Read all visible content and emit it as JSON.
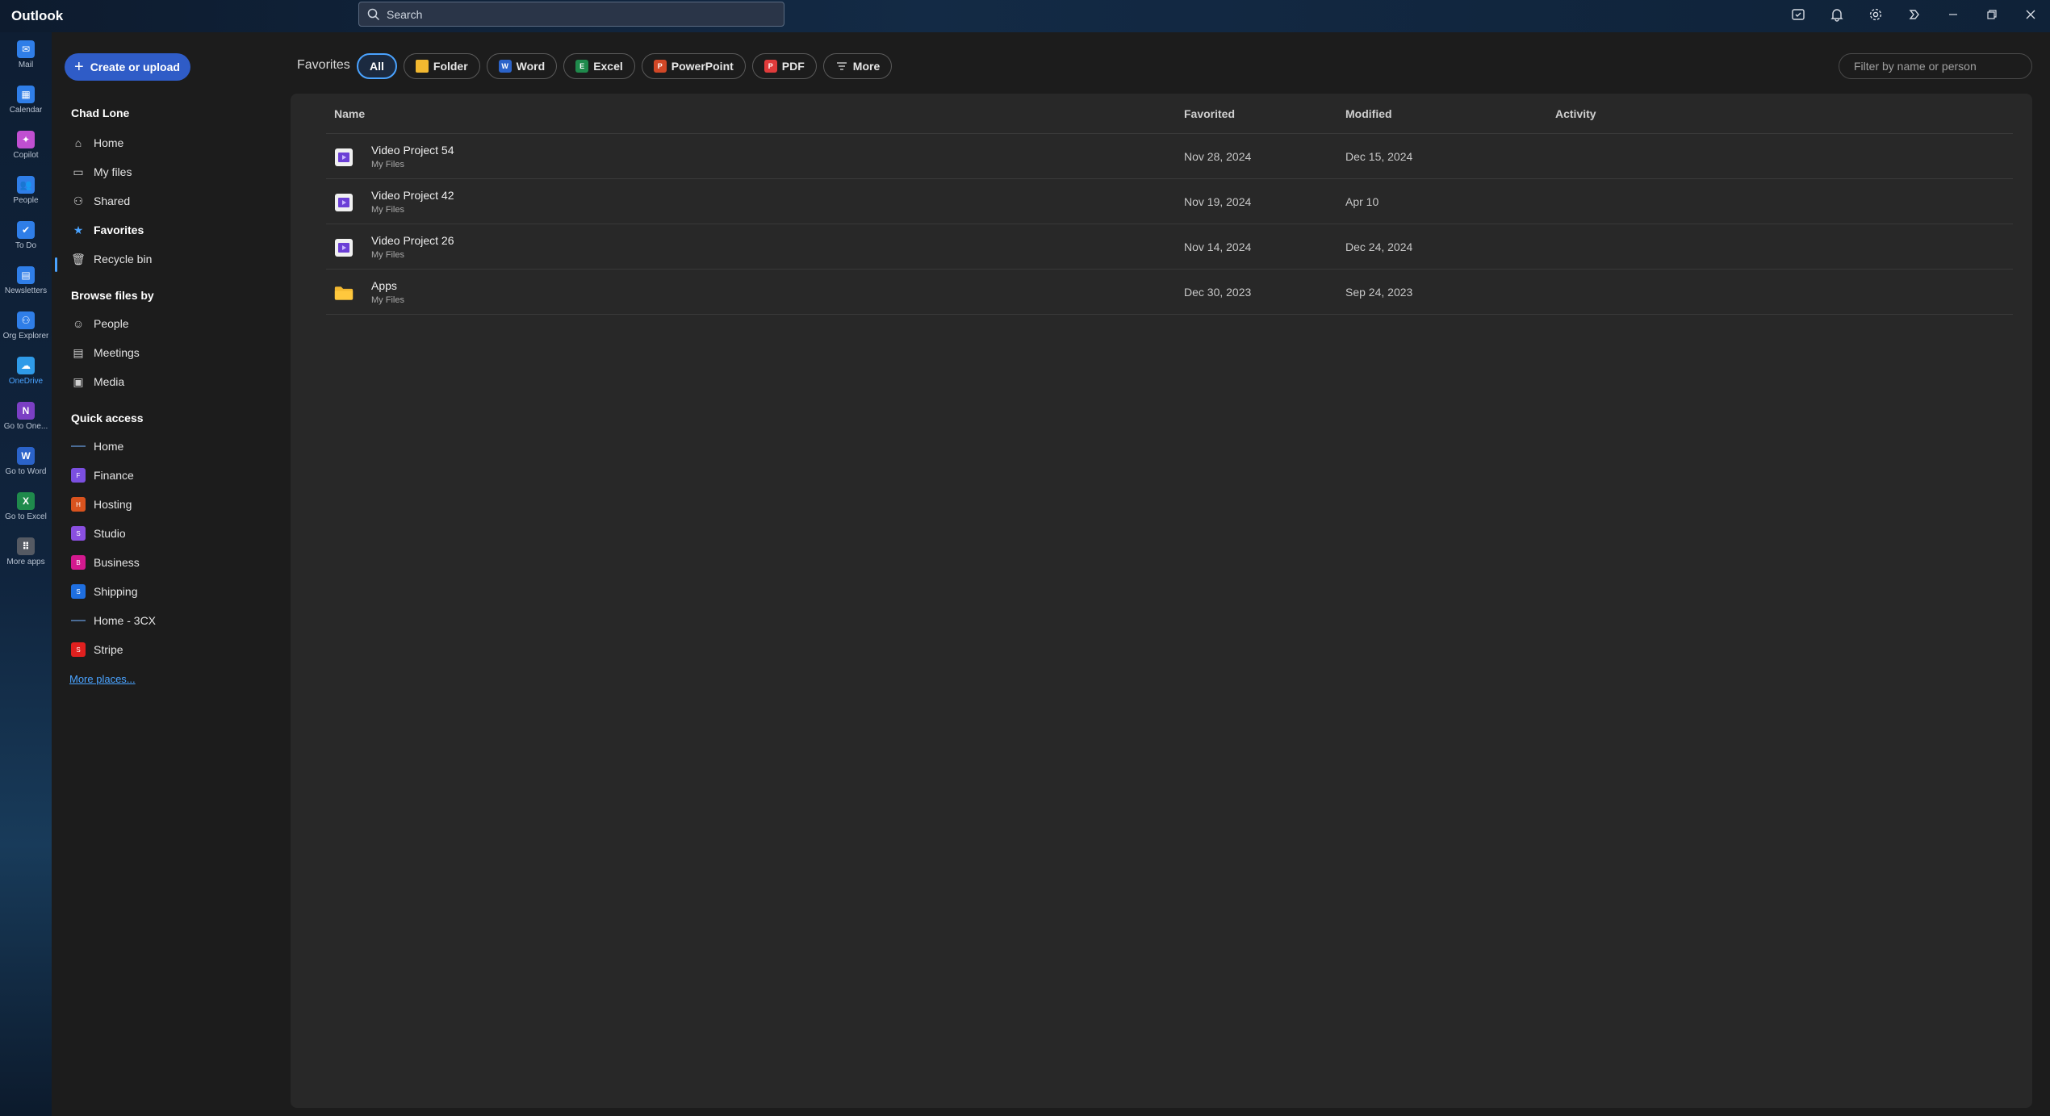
{
  "window": {
    "app_name": "Outlook",
    "search_placeholder": "Search"
  },
  "rail": [
    {
      "label": "Mail",
      "icon": "mail-icon",
      "color": "#2f7ee8",
      "glyph": "✉"
    },
    {
      "label": "Calendar",
      "icon": "calendar-icon",
      "color": "#2f7ee8",
      "glyph": "▦"
    },
    {
      "label": "Copilot",
      "icon": "copilot-icon",
      "color": "#c04fd1",
      "glyph": "✦"
    },
    {
      "label": "People",
      "icon": "people-icon",
      "color": "#2f7ee8",
      "glyph": "👥"
    },
    {
      "label": "To Do",
      "icon": "todo-icon",
      "color": "#2f7ee8",
      "glyph": "✔"
    },
    {
      "label": "Newsletters",
      "icon": "newsletters-icon",
      "color": "#2f7ee8",
      "glyph": "▤"
    },
    {
      "label": "Org Explorer",
      "icon": "org-explorer-icon",
      "color": "#2f7ee8",
      "glyph": "⚇"
    },
    {
      "label": "OneDrive",
      "icon": "onedrive-icon",
      "color": "#2f9be8",
      "glyph": "☁"
    },
    {
      "label": "Go to One...",
      "icon": "onenote-icon",
      "color": "#7b3fc4",
      "glyph": "N"
    },
    {
      "label": "Go to Word",
      "icon": "word-icon",
      "color": "#2b63c9",
      "glyph": "W"
    },
    {
      "label": "Go to Excel",
      "icon": "excel-icon",
      "color": "#1f8a4c",
      "glyph": "X"
    },
    {
      "label": "More apps",
      "icon": "more-apps-icon",
      "color": "#555a63",
      "glyph": "⠿"
    }
  ],
  "leftnav": {
    "create_label": "Create or upload",
    "user_name": "Chad Lone",
    "items": [
      {
        "label": "Home",
        "icon": "home-icon",
        "glyph": "⌂"
      },
      {
        "label": "My files",
        "icon": "folder-icon",
        "glyph": "▭"
      },
      {
        "label": "Shared",
        "icon": "shared-icon",
        "glyph": "⚇"
      },
      {
        "label": "Favorites",
        "icon": "star-icon",
        "glyph": "★"
      },
      {
        "label": "Recycle bin",
        "icon": "recycle-bin-icon",
        "glyph": "🗑"
      }
    ],
    "browse_title": "Browse files by",
    "browse_items": [
      {
        "label": "People",
        "icon": "person-icon",
        "glyph": "☺"
      },
      {
        "label": "Meetings",
        "icon": "meetings-icon",
        "glyph": "▤"
      },
      {
        "label": "Media",
        "icon": "media-icon",
        "glyph": "▣"
      }
    ],
    "quick_title": "Quick access",
    "quick_items": [
      {
        "label": "Home",
        "kind": "line",
        "color": "#4b6c96",
        "letter": ""
      },
      {
        "label": "Finance",
        "kind": "square",
        "color": "#7b4fe0",
        "letter": "F"
      },
      {
        "label": "Hosting",
        "kind": "square",
        "color": "#d9531e",
        "letter": "H"
      },
      {
        "label": "Studio",
        "kind": "square",
        "color": "#8a4fe0",
        "letter": "S"
      },
      {
        "label": "Business",
        "kind": "square",
        "color": "#d4198e",
        "letter": "B"
      },
      {
        "label": "Shipping",
        "kind": "square",
        "color": "#1f6fe0",
        "letter": "S"
      },
      {
        "label": "Home - 3CX",
        "kind": "line",
        "color": "#4b6c96",
        "letter": ""
      },
      {
        "label": "Stripe",
        "kind": "square",
        "color": "#e0201f",
        "letter": "S"
      }
    ],
    "more_places": "More places..."
  },
  "main": {
    "filter_title": "Favorites",
    "chips": [
      {
        "label": "All",
        "icon": "",
        "color": ""
      },
      {
        "label": "Folder",
        "icon": "folder-icon",
        "color": "#f2b830"
      },
      {
        "label": "Word",
        "icon": "word-icon",
        "color": "#2b63c9"
      },
      {
        "label": "Excel",
        "icon": "excel-icon",
        "color": "#1f8a4c"
      },
      {
        "label": "PowerPoint",
        "icon": "powerpoint-icon",
        "color": "#d24726"
      },
      {
        "label": "PDF",
        "icon": "pdf-icon",
        "color": "#e03b3b"
      },
      {
        "label": "More",
        "icon": "filter-icon",
        "color": ""
      }
    ],
    "filter_placeholder": "Filter by name or person",
    "columns": {
      "name": "Name",
      "favorited": "Favorited",
      "modified": "Modified",
      "activity": "Activity"
    },
    "rows": [
      {
        "name": "Video Project 54",
        "location": "My Files",
        "favorited": "Nov 28, 2024",
        "modified": "Dec 15, 2024",
        "type": "video"
      },
      {
        "name": "Video Project 42",
        "location": "My Files",
        "favorited": "Nov 19, 2024",
        "modified": "Apr 10",
        "type": "video"
      },
      {
        "name": "Video Project 26",
        "location": "My Files",
        "favorited": "Nov 14, 2024",
        "modified": "Dec 24, 2024",
        "type": "video"
      },
      {
        "name": "Apps",
        "location": "My Files",
        "favorited": "Dec 30, 2023",
        "modified": "Sep 24, 2023",
        "type": "folder"
      }
    ]
  }
}
